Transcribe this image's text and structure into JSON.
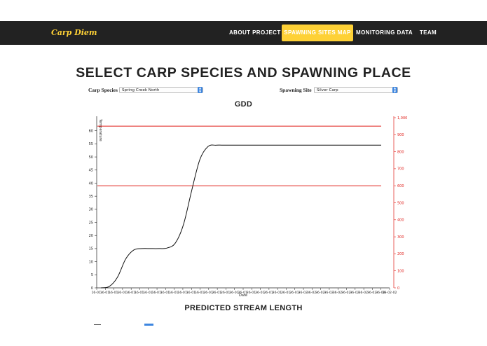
{
  "nav": {
    "brand": "Carp Diem",
    "items": [
      {
        "label": "ABOUT PROJECT",
        "active": false
      },
      {
        "label": "SPAWNING SITES MAP",
        "active": true
      },
      {
        "label": "MONITORING DATA",
        "active": false
      },
      {
        "label": "TEAM",
        "active": false
      }
    ]
  },
  "main": {
    "title": "SELECT CARP SPECIES AND SPAWNING PLACE",
    "species_label": "Carp Species",
    "species_value": "Spring Creek North",
    "site_label": "Spawning Site",
    "site_value": "Silver Carp",
    "chart_title": "GDD",
    "second_title": "PREDICTED STREAM LENGTH"
  },
  "colors": {
    "nav_bg": "#222222",
    "accent": "#fed136",
    "threshold": "#e0201b",
    "series": "#111111",
    "select_arrow": "#3d86e0"
  },
  "chart_data": {
    "type": "line",
    "title": "GDD",
    "ylabel": "Temperature",
    "xlabel": "Date",
    "ylim": [
      0,
      65
    ],
    "y_ticks": [
      0,
      5,
      10,
      15,
      20,
      25,
      30,
      35,
      40,
      45,
      50,
      55,
      60
    ],
    "y2lim": [
      0,
      1000
    ],
    "y2_ticks": [
      "0",
      "100",
      "200",
      "300",
      "400",
      "500",
      "600",
      "700",
      "800",
      "900",
      "1,000"
    ],
    "x_tick_labels": [
      "16-01-",
      "16-01-",
      "16-01-",
      "16-01-",
      "16-01-",
      "16-01-",
      "16-01-",
      "16-01-",
      "16-01-",
      "16-01-",
      "16-01-",
      "16-01-",
      "16-01-",
      "26-01-",
      "26-01-",
      "26-01-",
      "26-01-",
      "26-01-",
      "26-01-",
      "26-01-",
      "26-01-",
      "26-01-",
      "26-01-",
      "26-01-",
      "36-02-",
      "36-02-",
      "36-02-",
      "36-02-",
      "36-02-",
      "36-02-",
      "36-02-",
      "36-02-",
      "36-02-",
      "36-02-",
      "36-02-02"
    ],
    "series": [
      {
        "values": [
          0,
          0.5,
          4,
          11,
          14.5,
          15,
          15,
          15,
          15.2,
          17,
          24,
          37,
          49,
          54,
          54.5,
          54.5,
          54.5,
          54.5,
          54.5,
          54.5,
          54.5,
          54.5,
          54.5,
          54.5,
          54.5,
          54.5,
          54.5,
          54.5,
          54.5,
          54.5,
          54.5,
          54.5,
          54.5,
          54.5,
          54.5
        ]
      }
    ],
    "thresholds_right_axis": [
      950,
      600
    ]
  }
}
